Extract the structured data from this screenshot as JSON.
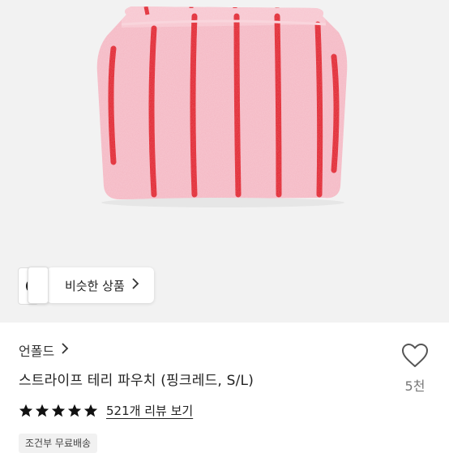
{
  "similar": {
    "label": "비슷한 상품"
  },
  "product": {
    "brand": "언폴드",
    "title": "스트라이프 테리 파우치 (핑크레드, S/L)",
    "likes": "5천",
    "rating": 5,
    "reviews_label": "521개 리뷰 보기",
    "shipping_badge": "조건부 무료배송"
  },
  "colors": {
    "pouch_pink": "#f4b6c2",
    "stripe_red": "#e01f2a",
    "background": "#f2f2f2"
  },
  "icons": {
    "brand_chevron": "chevron-right-icon",
    "like": "heart-outline-icon",
    "star": "star-filled-icon"
  }
}
